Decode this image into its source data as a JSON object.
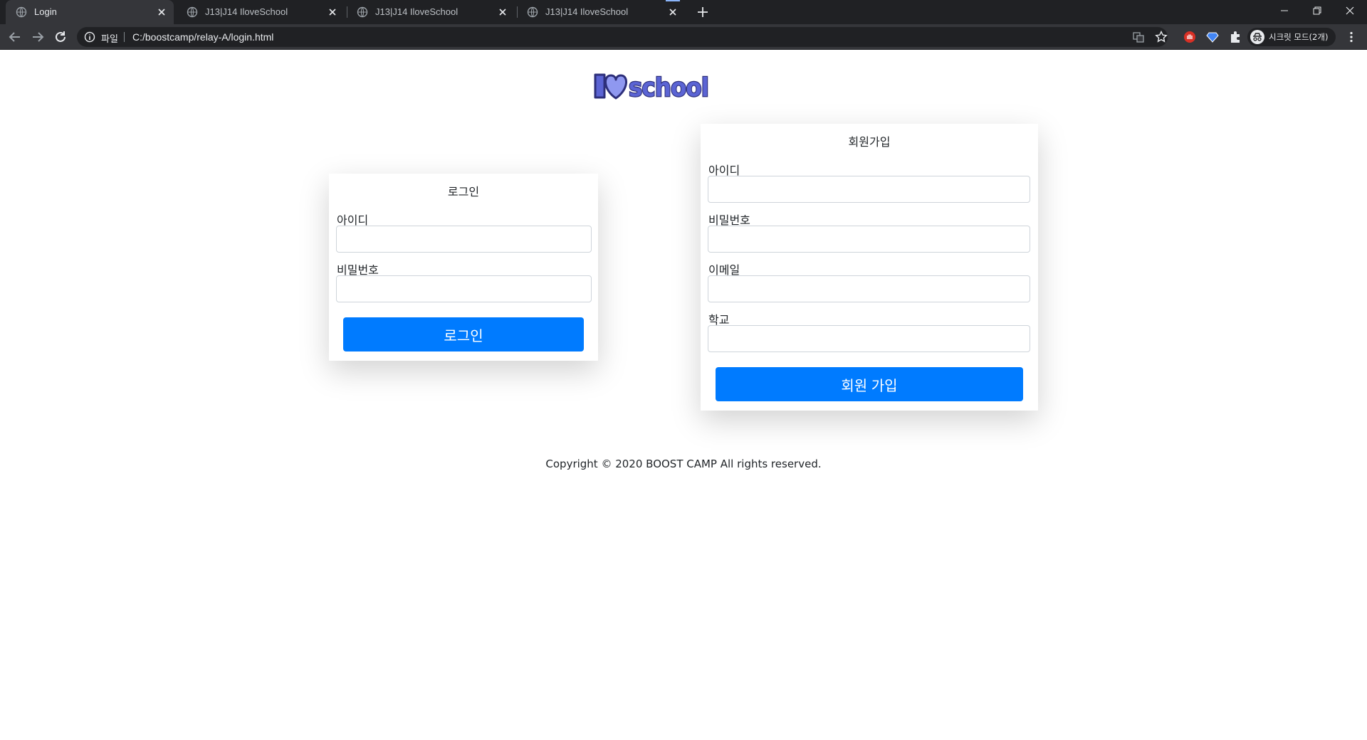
{
  "browser": {
    "tabs": [
      {
        "title": "Login",
        "active": true
      },
      {
        "title": "J13|J14 IloveSchool",
        "active": false
      },
      {
        "title": "J13|J14 IloveSchool",
        "active": false
      },
      {
        "title": "J13|J14 IloveSchool",
        "active": false
      }
    ],
    "address": {
      "scheme_label": "파일",
      "url": "C:/boostcamp/relay-A/login.html"
    },
    "profile_label": "시크릿 모드(2개)",
    "colors": {
      "tabbar": "#202124",
      "toolbar": "#35363a",
      "text": "#e8eaed",
      "accent": "#8ab4f8"
    }
  },
  "page": {
    "logo_text": "I♥school",
    "login": {
      "title": "로그인",
      "id_label": "아이디",
      "id_value": "",
      "password_label": "비밀번호",
      "password_value": "",
      "submit_label": "로그인"
    },
    "signup": {
      "title": "회원가입",
      "id_label": "아이디",
      "id_value": "",
      "password_label": "비밀번호",
      "password_value": "",
      "email_label": "이메일",
      "email_value": "",
      "school_label": "학교",
      "school_value": "",
      "submit_label": "회원 가입"
    },
    "footer": {
      "copyright": "Copyright © 2020 BOOST CAMP All rights reserved."
    },
    "colors": {
      "primary_button": "#007bff",
      "input_border": "#ced4da",
      "text": "#212529",
      "logo_fill": "#5b64d4"
    }
  }
}
